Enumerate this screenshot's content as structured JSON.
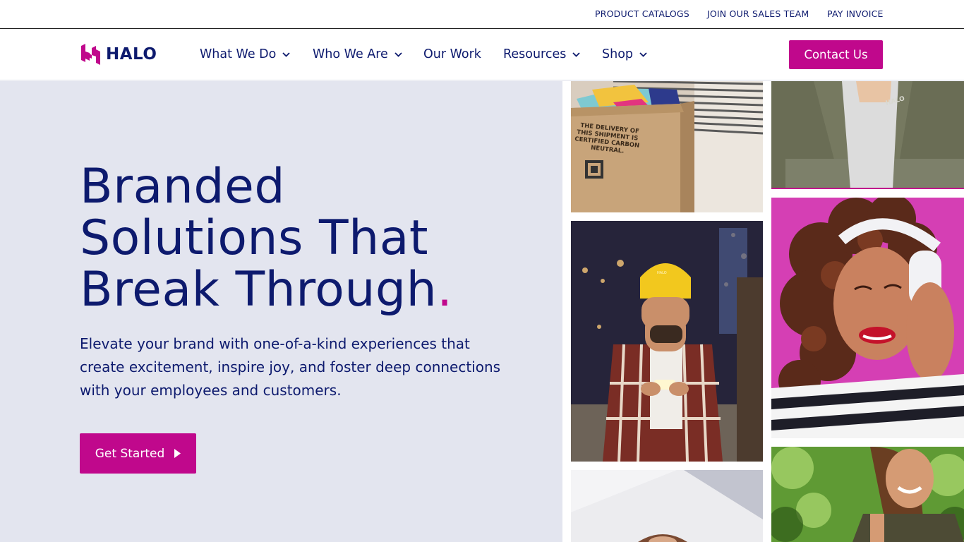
{
  "utility_nav": {
    "links": [
      "PRODUCT CATALOGS",
      "JOIN OUR SALES TEAM",
      "PAY INVOICE"
    ]
  },
  "brand": {
    "name": "HALO",
    "accent": "#c0088c",
    "navy": "#0d1a6e"
  },
  "main_nav": {
    "items": [
      {
        "label": "What We Do",
        "icon": "chevron-down-icon"
      },
      {
        "label": "Who We Are",
        "icon": "chevron-down-icon"
      },
      {
        "label": "Our Work"
      },
      {
        "label": "Resources",
        "icon": "chevron-down-icon"
      },
      {
        "label": "Shop",
        "icon": "chevron-down-icon"
      }
    ],
    "contact_label": "Contact Us"
  },
  "hero": {
    "title_lines": [
      "Branded",
      "Solutions That",
      "Break Through"
    ],
    "title_dot": ".",
    "subtitle": "Elevate your brand with one-of-a-kind experiences that create excitement, inspire joy, and foster deep connections with your employees and customers.",
    "cta_label": "Get Started",
    "background": "#e3e5ef"
  },
  "gallery": {
    "box_print": [
      "THE DELIVERY OF",
      "THIS SHIPMENT IS",
      "CERTIFIED CARBON",
      "NEUTRAL."
    ],
    "cap_logo": "HALO",
    "jacket_logo": "HALO"
  }
}
